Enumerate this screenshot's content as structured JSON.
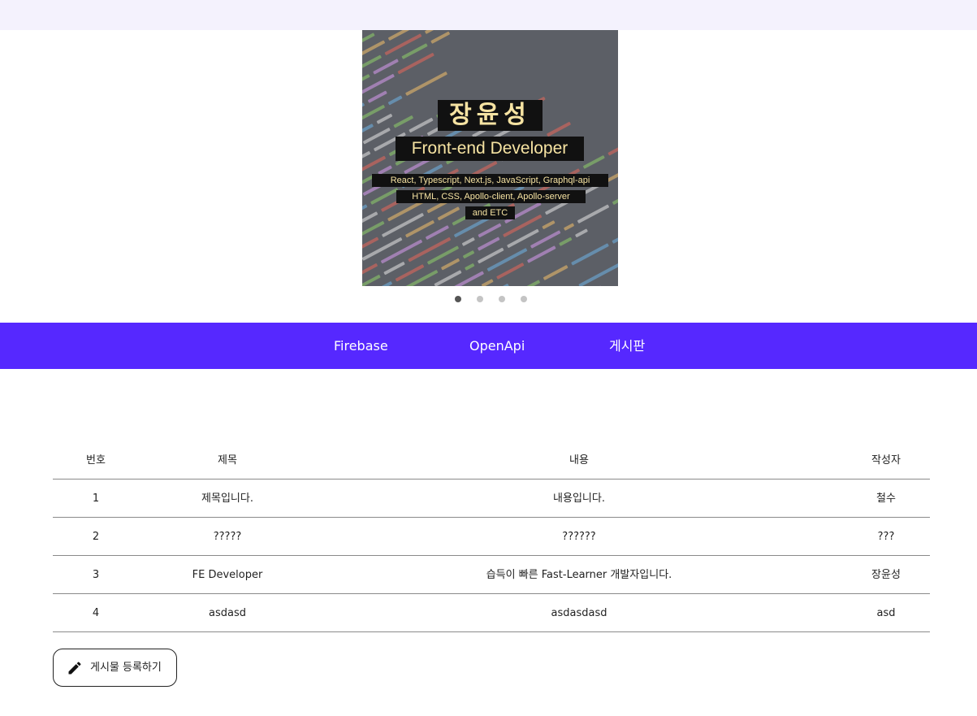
{
  "banner": {
    "name": "장윤성",
    "role": "Front-end Developer",
    "skills_line1": "React, Typescript, Next.js, JavaScript, Graphql-api",
    "skills_line2": "HTML, CSS, Apollo-client, Apollo-server",
    "skills_line3": "and ETC",
    "slide_count": 4,
    "active_slide": 1
  },
  "nav": {
    "items": [
      {
        "label": "Firebase"
      },
      {
        "label": "OpenApi"
      },
      {
        "label": "게시판"
      }
    ]
  },
  "board": {
    "columns": [
      "번호",
      "제목",
      "내용",
      "작성자"
    ],
    "rows": [
      {
        "num": "1",
        "title": "제목입니다.",
        "content": "내용입니다.",
        "writer": "철수"
      },
      {
        "num": "2",
        "title": "?????",
        "content": "??????",
        "writer": "???"
      },
      {
        "num": "3",
        "title": "FE Developer",
        "content": "습득이 빠른 Fast-Learner 개발자입니다.",
        "writer": "장윤성"
      },
      {
        "num": "4",
        "title": "asdasd",
        "content": "asdasdasd",
        "writer": "asd"
      }
    ]
  },
  "actions": {
    "create_post_label": "게시물 등록하기",
    "create_post_icon": "pencil-icon"
  },
  "colors": {
    "topbar": "#f4f2fd",
    "nav": "#5628ff",
    "banner_text": "#f6e3a2"
  }
}
